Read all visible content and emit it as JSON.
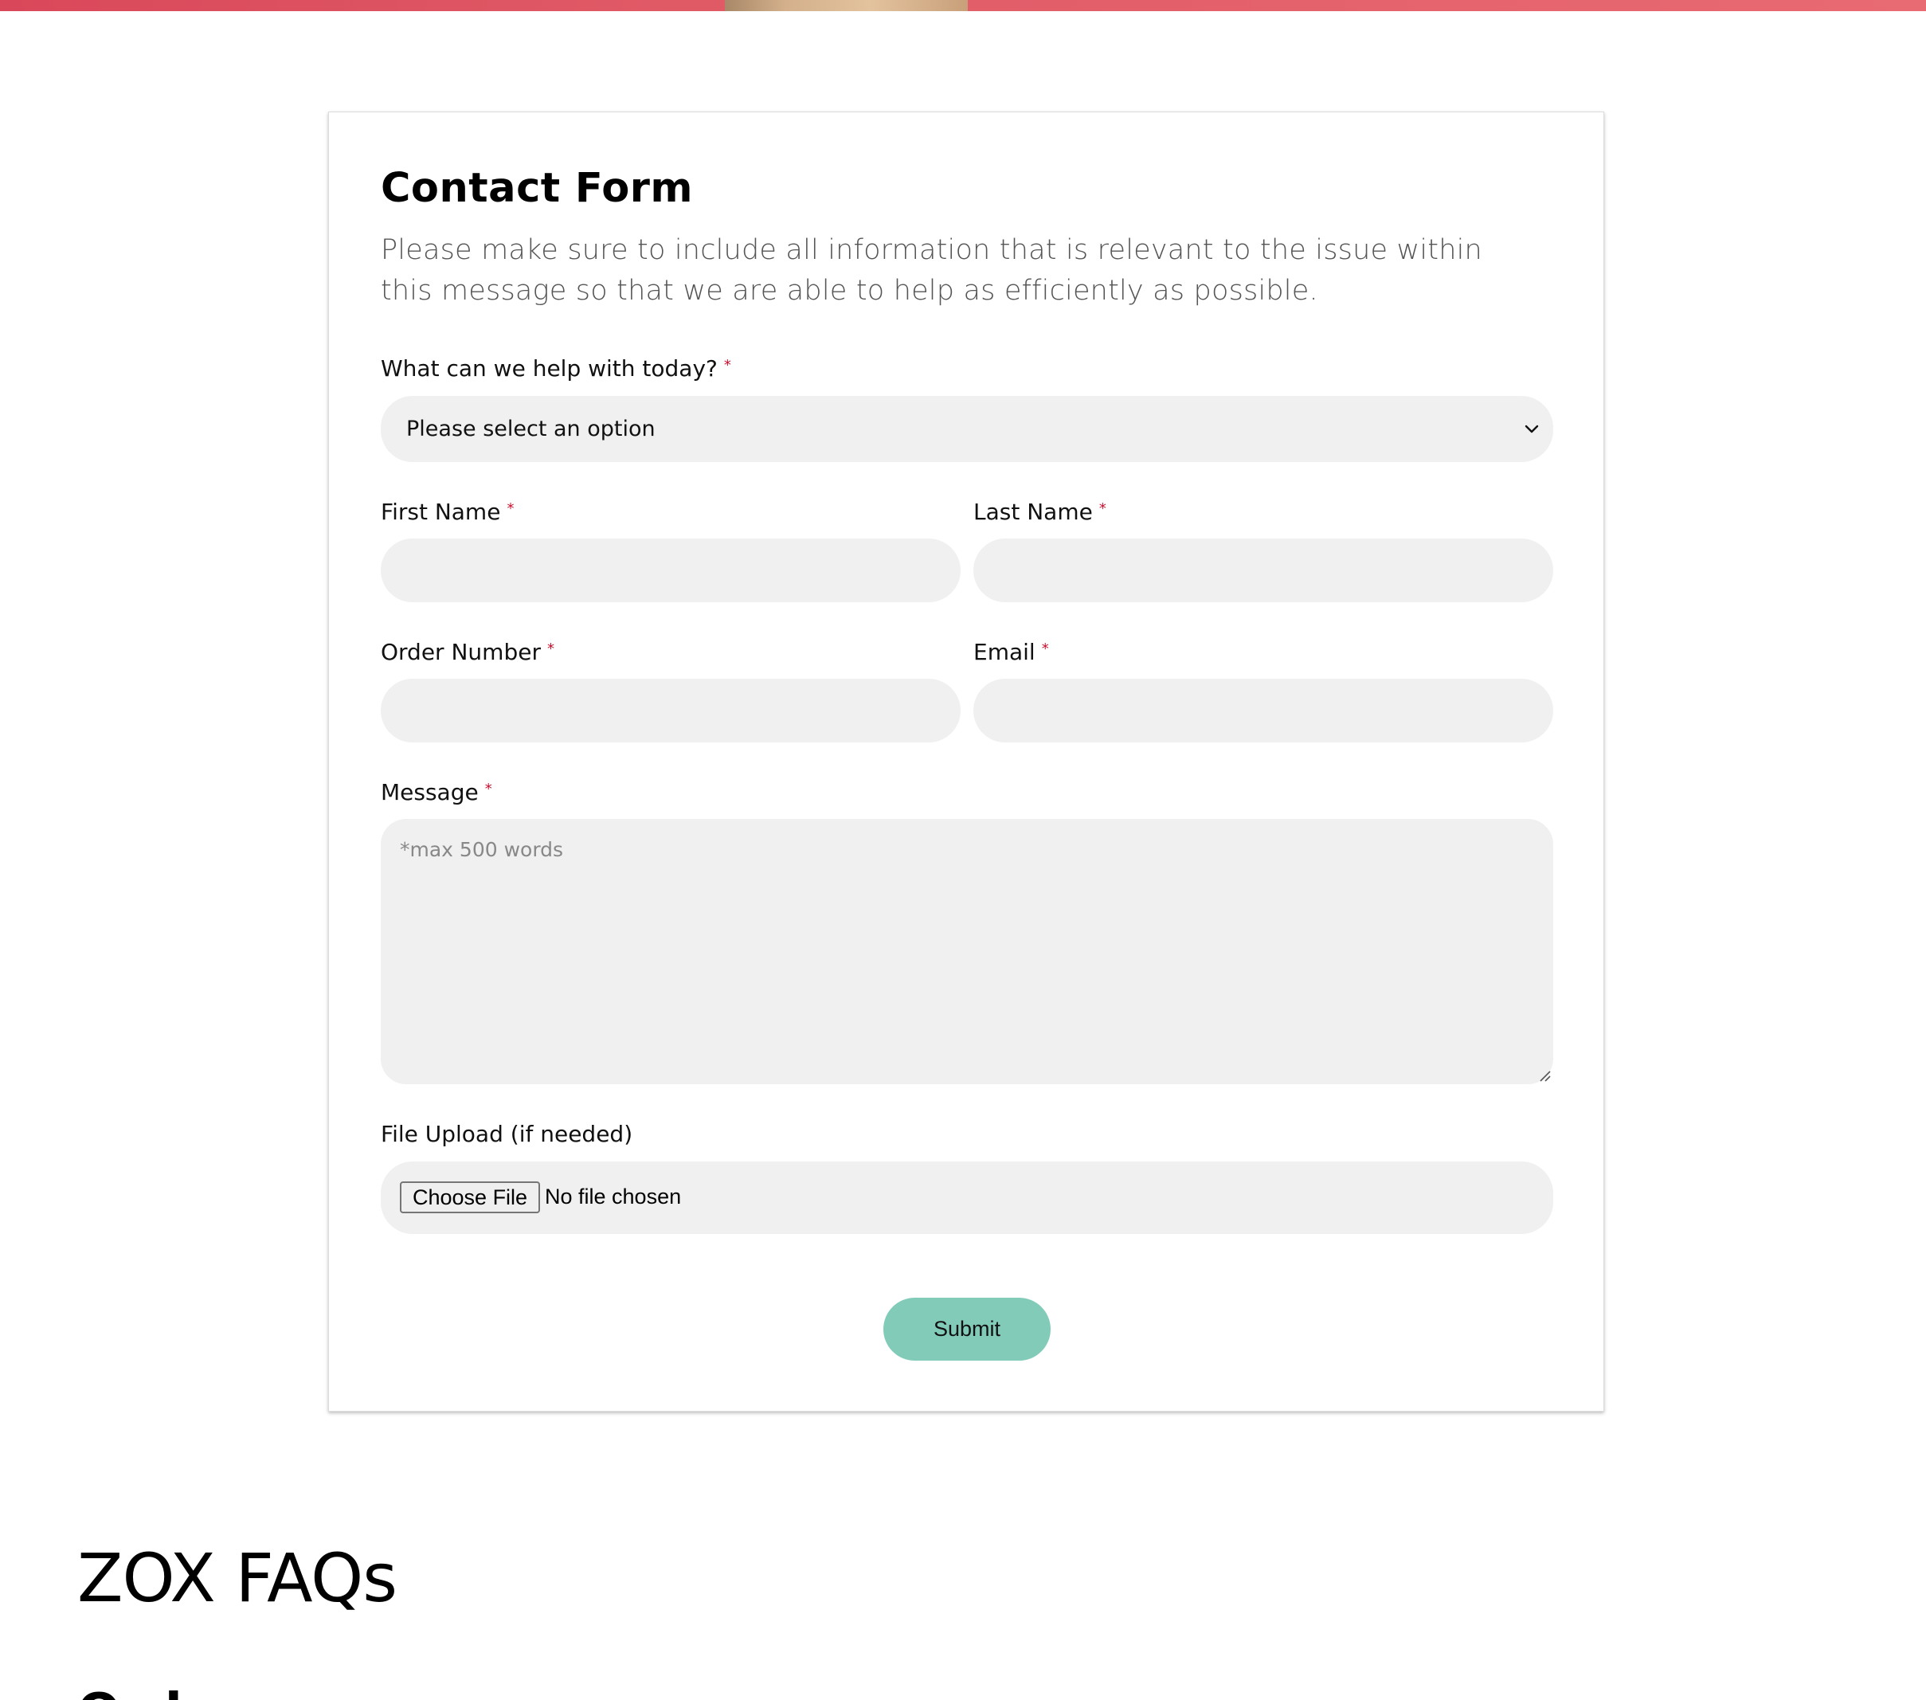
{
  "form": {
    "title": "Contact Form",
    "description": "Please make sure to include all information that is relevant to the issue within this message so that we are able to help as efficiently as possible.",
    "help_label": "What can we help with today?",
    "help_select_value": "Please select an option",
    "first_name_label": "First Name",
    "last_name_label": "Last Name",
    "order_number_label": "Order Number",
    "email_label": "Email",
    "message_label": "Message",
    "message_placeholder": "*max 500 words",
    "file_upload_label": "File Upload (if needed)",
    "choose_file_label": "Choose File",
    "file_status": "No file chosen",
    "submit_label": "Submit",
    "required_marker": "*"
  },
  "faq": {
    "heading": "ZOX FAQs",
    "section_title": "Orders"
  },
  "colors": {
    "top_band": "#e05a66",
    "input_bg": "#f0f0f0",
    "submit_bg": "#82cbb9",
    "required": "#c8102e"
  }
}
